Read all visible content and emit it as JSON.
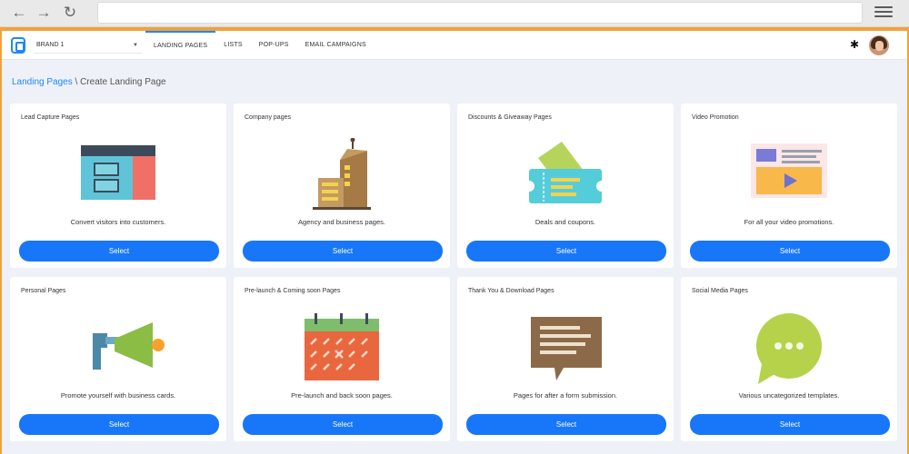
{
  "browser": {
    "menu_icon": "hamburger-icon"
  },
  "nav": {
    "brand": "BRAND 1",
    "links": [
      "LANDING PAGES",
      "LISTS",
      "POP-UPS",
      "EMAIL CAMPAIGNS"
    ]
  },
  "breadcrumb": {
    "link": "Landing Pages",
    "separator": " \\ ",
    "current": "Create Landing Page"
  },
  "cards": [
    {
      "title": "Lead Capture Pages",
      "description": "Convert visitors into customers.",
      "button": "Select"
    },
    {
      "title": "Company pages",
      "description": "Agency and business pages.",
      "button": "Select"
    },
    {
      "title": "Discounts & Giveaway Pages",
      "description": "Deals and coupons.",
      "button": "Select"
    },
    {
      "title": "Video Promotion",
      "description": "For all your video promotions.",
      "button": "Select"
    },
    {
      "title": "Personal Pages",
      "description": "Promote yourself with business cards.",
      "button": "Select"
    },
    {
      "title": "Pre-launch & Coming soon Pages",
      "description": "Pre-launch and back soon pages.",
      "button": "Select"
    },
    {
      "title": "Thank You & Download Pages",
      "description": "Pages for after a form submission.",
      "button": "Select"
    },
    {
      "title": "Social Media Pages",
      "description": "Various uncategorized templates.",
      "button": "Select"
    }
  ],
  "colors": {
    "accent": "#1877f8",
    "page_bg": "#eef1f8"
  }
}
